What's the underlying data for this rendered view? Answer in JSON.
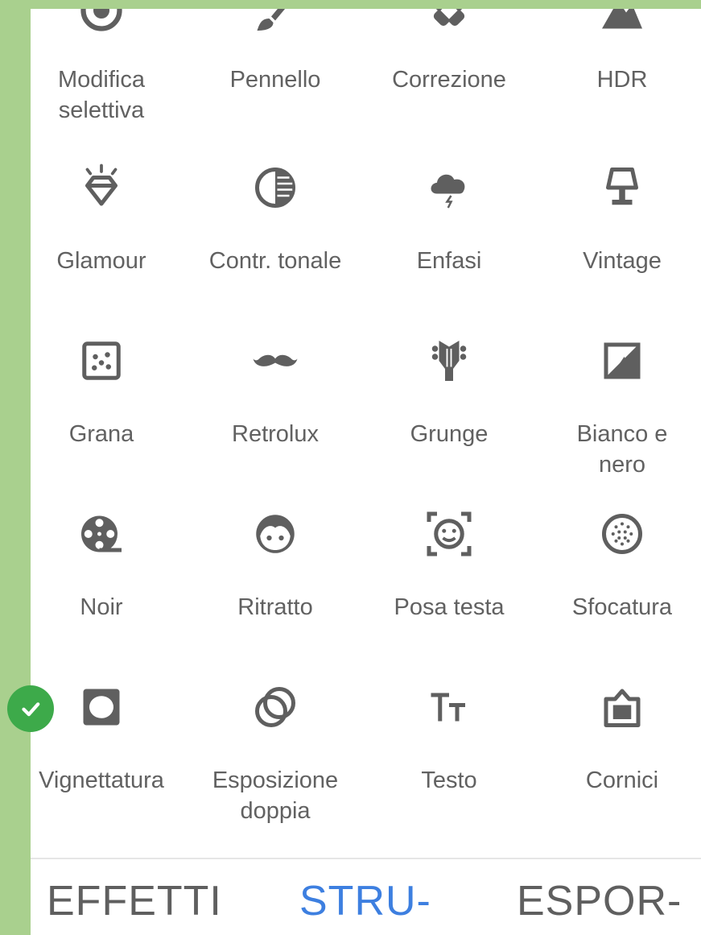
{
  "tools": [
    {
      "label": "Modifica\nselettiva",
      "icon": "selective-target-icon"
    },
    {
      "label": "Pennello",
      "icon": "brush-icon"
    },
    {
      "label": "Correzione",
      "icon": "healing-bandage-icon"
    },
    {
      "label": "HDR",
      "icon": "mountain-hdr-icon"
    },
    {
      "label": "Glamour",
      "icon": "diamond-icon"
    },
    {
      "label": "Contr. tonale",
      "icon": "tonal-contrast-icon"
    },
    {
      "label": "Enfasi",
      "icon": "storm-cloud-icon"
    },
    {
      "label": "Vintage",
      "icon": "lamp-icon"
    },
    {
      "label": "Grana",
      "icon": "grain-dots-icon"
    },
    {
      "label": "Retrolux",
      "icon": "mustache-icon"
    },
    {
      "label": "Grunge",
      "icon": "guitar-head-icon"
    },
    {
      "label": "Bianco e\nnero",
      "icon": "black-white-icon"
    },
    {
      "label": "Noir",
      "icon": "film-reel-icon"
    },
    {
      "label": "Ritratto",
      "icon": "face-icon"
    },
    {
      "label": "Posa testa",
      "icon": "face-frame-icon"
    },
    {
      "label": "Sfocatura",
      "icon": "lens-blur-icon"
    },
    {
      "label": "Vignettatura",
      "icon": "vignette-icon"
    },
    {
      "label": "Esposizione\ndoppia",
      "icon": "double-exposure-icon"
    },
    {
      "label": "Testo",
      "icon": "text-icon"
    },
    {
      "label": "Cornici",
      "icon": "frame-icon"
    }
  ],
  "tabs": [
    {
      "label": "EFFETTI",
      "active": false
    },
    {
      "label": "STRU-",
      "active": true
    },
    {
      "label": "ESPOR-",
      "active": false
    }
  ],
  "colors": {
    "icon": "#5f5f5f",
    "label": "#616161",
    "active_tab": "#3d7fe0",
    "check": "#3daa4a",
    "background": "#a9d08e"
  }
}
